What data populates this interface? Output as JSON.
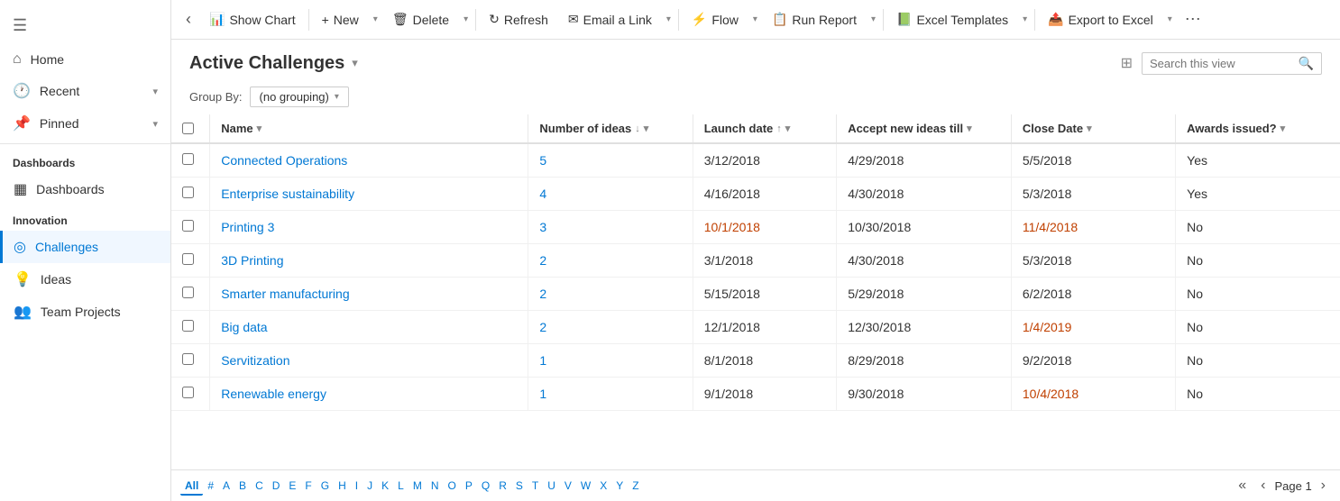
{
  "sidebar": {
    "hamburger": "≡",
    "top_items": [
      {
        "id": "home",
        "icon": "⌂",
        "label": "Home"
      },
      {
        "id": "recent",
        "icon": "🕐",
        "label": "Recent",
        "chevron": "▾"
      },
      {
        "id": "pinned",
        "icon": "📌",
        "label": "Pinned",
        "chevron": "▾"
      }
    ],
    "groups": [
      {
        "label": "Dashboards",
        "items": [
          {
            "id": "dashboards",
            "icon": "▦",
            "label": "Dashboards"
          }
        ]
      },
      {
        "label": "Innovation",
        "items": [
          {
            "id": "challenges",
            "icon": "◎",
            "label": "Challenges",
            "active": true
          },
          {
            "id": "ideas",
            "icon": "💡",
            "label": "Ideas"
          },
          {
            "id": "team-projects",
            "icon": "👥",
            "label": "Team Projects"
          }
        ]
      }
    ]
  },
  "toolbar": {
    "back_label": "‹",
    "show_chart_label": "Show Chart",
    "new_label": "New",
    "delete_label": "Delete",
    "refresh_label": "Refresh",
    "email_link_label": "Email a Link",
    "flow_label": "Flow",
    "run_report_label": "Run Report",
    "excel_templates_label": "Excel Templates",
    "export_excel_label": "Export to Excel"
  },
  "page": {
    "title": "Active Challenges",
    "title_chevron": "▾",
    "search_placeholder": "Search this view",
    "group_by_label": "Group By:",
    "group_by_value": "(no grouping)",
    "filter_icon": "⊞"
  },
  "columns": [
    {
      "id": "name",
      "label": "Name",
      "sort": "▾",
      "filter": ""
    },
    {
      "id": "ideas",
      "label": "Number of ideas",
      "sort": "↓",
      "filter": "▾"
    },
    {
      "id": "launch",
      "label": "Launch date",
      "sort": "↑",
      "filter": "▾"
    },
    {
      "id": "accept",
      "label": "Accept new ideas till",
      "sort": "",
      "filter": "▾"
    },
    {
      "id": "close",
      "label": "Close Date",
      "sort": "",
      "filter": "▾"
    },
    {
      "id": "awards",
      "label": "Awards issued?",
      "sort": "",
      "filter": "▾"
    }
  ],
  "rows": [
    {
      "name": "Connected Operations",
      "ideas": "5",
      "launch": "3/12/2018",
      "accept": "4/29/2018",
      "close": "5/5/2018",
      "awards": "Yes",
      "launch_orange": false,
      "close_orange": false
    },
    {
      "name": "Enterprise sustainability",
      "ideas": "4",
      "launch": "4/16/2018",
      "accept": "4/30/2018",
      "close": "5/3/2018",
      "awards": "Yes",
      "launch_orange": false,
      "close_orange": false
    },
    {
      "name": "Printing 3",
      "ideas": "3",
      "launch": "10/1/2018",
      "accept": "10/30/2018",
      "close": "11/4/2018",
      "awards": "No",
      "launch_orange": true,
      "close_orange": true
    },
    {
      "name": "3D Printing",
      "ideas": "2",
      "launch": "3/1/2018",
      "accept": "4/30/2018",
      "close": "5/3/2018",
      "awards": "No",
      "launch_orange": false,
      "close_orange": false
    },
    {
      "name": "Smarter manufacturing",
      "ideas": "2",
      "launch": "5/15/2018",
      "accept": "5/29/2018",
      "close": "6/2/2018",
      "awards": "No",
      "launch_orange": false,
      "close_orange": false
    },
    {
      "name": "Big data",
      "ideas": "2",
      "launch": "12/1/2018",
      "accept": "12/30/2018",
      "close": "1/4/2019",
      "awards": "No",
      "launch_orange": false,
      "close_orange": true
    },
    {
      "name": "Servitization",
      "ideas": "1",
      "launch": "8/1/2018",
      "accept": "8/29/2018",
      "close": "9/2/2018",
      "awards": "No",
      "launch_orange": false,
      "close_orange": false
    },
    {
      "name": "Renewable energy",
      "ideas": "1",
      "launch": "9/1/2018",
      "accept": "9/30/2018",
      "close": "10/4/2018",
      "awards": "No",
      "launch_orange": false,
      "close_orange": true
    }
  ],
  "alpha_bar": {
    "page_label": "Page 1",
    "chars": [
      "All",
      "#",
      "A",
      "B",
      "C",
      "D",
      "E",
      "F",
      "G",
      "H",
      "I",
      "J",
      "K",
      "L",
      "M",
      "N",
      "O",
      "P",
      "Q",
      "R",
      "S",
      "T",
      "U",
      "V",
      "W",
      "X",
      "Y",
      "Z"
    ]
  }
}
